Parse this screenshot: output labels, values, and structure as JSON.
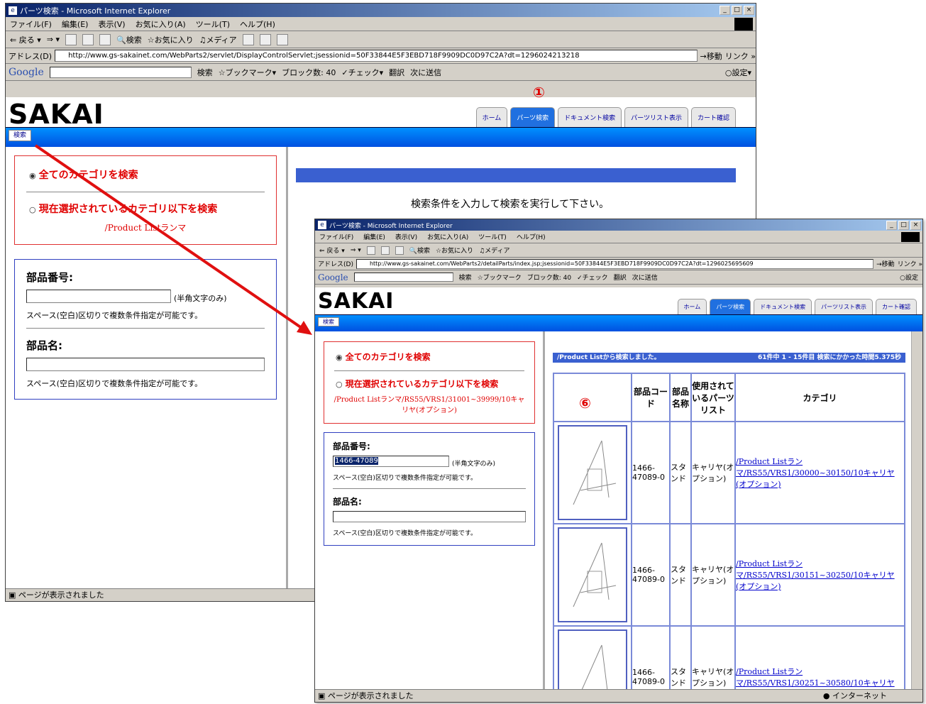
{
  "winA": {
    "title": "パーツ検索 - Microsoft Internet Explorer",
    "menu": [
      "ファイル(F)",
      "編集(E)",
      "表示(V)",
      "お気に入り(A)",
      "ツール(T)",
      "ヘルプ(H)"
    ],
    "toolbar": {
      "back": "戻る",
      "search": "検索",
      "favorites": "お気に入り",
      "media": "メディア"
    },
    "address_label": "アドレス(D)",
    "url": "http://www.gs-sakainet.com/WebParts2/servlet/DisplayControlServlet;jsessionid=50F33844E5F3EBD718F9909DC0D97C2A?dt=1296024213218",
    "go": "移動",
    "links": "リンク »",
    "google": {
      "logo": "Google",
      "search": "検索",
      "bookmarks": "ブックマーク",
      "blocked": "ブロック数: 40",
      "check": "チェック",
      "translate": "翻訳",
      "send": "次に送信",
      "settings": "設定"
    },
    "logo": "SAKAI",
    "tabs": [
      "ホーム",
      "パーツ検索",
      "ドキュメント検索",
      "パーツリスト表示",
      "カート確認"
    ],
    "search_btn": "検索",
    "opt_all": "全てのカテゴリを検索",
    "opt_sel": "現在選択されているカテゴリ以下を検索",
    "path": "/Product Listランマ",
    "part_no_label": "部品番号:",
    "part_no_value": "",
    "half_width": "(半角文字のみ)",
    "space_note": "スペース(空白)区切りで複数条件指定が可能です。",
    "part_name_label": "部品名:",
    "message": "検索条件を入力して検索を実行して下さい。",
    "status": "ページが表示されました",
    "marker": "①"
  },
  "winB": {
    "title": "パーツ検索 - Microsoft Internet Explorer",
    "menu": [
      "ファイル(F)",
      "編集(E)",
      "表示(V)",
      "お気に入り(A)",
      "ツール(T)",
      "ヘルプ(H)"
    ],
    "toolbar": {
      "back": "戻る",
      "search": "検索",
      "favorites": "お気に入り",
      "media": "メディア"
    },
    "address_label": "アドレス(D)",
    "url": "http://www.gs-sakainet.com/WebParts2/detailParts/index.jsp;jsessionid=50F33844E5F3EBD718F9909DC0D97C2A?dt=1296025695609",
    "go": "移動",
    "links": "リンク »",
    "google": {
      "logo": "Google",
      "search": "検索",
      "bookmarks": "ブックマーク",
      "blocked": "ブロック数: 40",
      "check": "チェック",
      "translate": "翻訳",
      "send": "次に送信",
      "settings": "設定"
    },
    "logo": "SAKAI",
    "tabs": [
      "ホーム",
      "パーツ検索",
      "ドキュメント検索",
      "パーツリスト表示",
      "カート確認"
    ],
    "search_btn": "検索",
    "opt_all": "全てのカテゴリを検索",
    "opt_sel": "現在選択されているカテゴリ以下を検索",
    "path": "/Product Listランマ/RS55/VRS1/31001~39999/10キャリヤ(オプション)",
    "part_no_label": "部品番号:",
    "part_no_value": "1466-47089",
    "half_width": "(半角文字のみ)",
    "space_note": "スペース(空白)区切りで複数条件指定が可能です。",
    "part_name_label": "部品名:",
    "results_left": "/Product Listから検索しました。",
    "results_right": "61件中 1 - 15件目 検索にかかった時間5.375秒",
    "columns": [
      "部品コード",
      "部品名称",
      "使用されているパーツリスト",
      "カテゴリ"
    ],
    "rows": [
      {
        "code": "1466-47089-0",
        "name": "スタンド",
        "list": "キャリヤ(オプション)",
        "cat": "/Product Listランマ/RS55/VRS1/30000~30150/10キャリヤ(オプション)"
      },
      {
        "code": "1466-47089-0",
        "name": "スタンド",
        "list": "キャリヤ(オプション)",
        "cat": "/Product Listランマ/RS55/VRS1/30151~30250/10キャリヤ(オプション)"
      },
      {
        "code": "1466-47089-0",
        "name": "スタンド",
        "list": "キャリヤ(オプション)",
        "cat": "/Product Listランマ/RS55/VRS1/30251~30580/10キャリヤ"
      }
    ],
    "status": "ページが表示されました",
    "zone": "インターネット",
    "marker": "⑥"
  },
  "colors": {
    "accent_red": "#e00000",
    "arrow_red": "#e01010",
    "nav_blue": "#0060f0",
    "title_blue": "#0a246a"
  }
}
